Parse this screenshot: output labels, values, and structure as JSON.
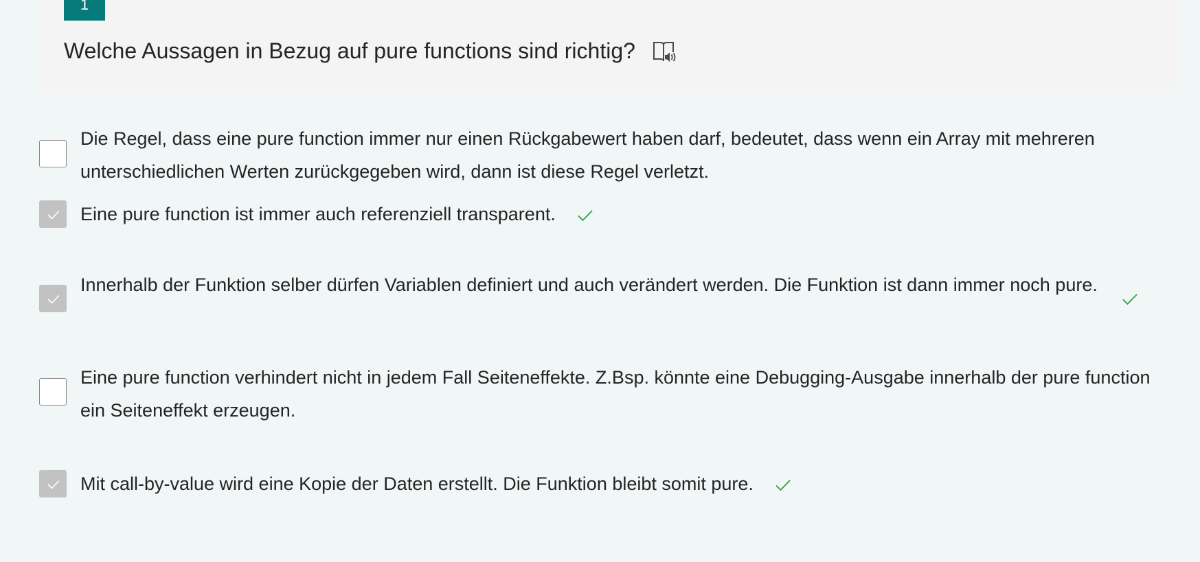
{
  "question": {
    "number": "1",
    "title": "Welche Aussagen in Bezug auf pure functions sind richtig?",
    "reader_icon": "immersive-reader-icon"
  },
  "options": [
    {
      "text": "Die Regel, dass eine pure function immer nur einen Rückgabewert haben darf, bedeutet, dass wenn ein Array mit mehreren unterschiedlichen Werten zurückgegeben wird, dann ist diese Regel verletzt.",
      "checked": false,
      "correct": false
    },
    {
      "text": "Eine pure function ist immer auch referenziell transparent.",
      "checked": true,
      "correct": true
    },
    {
      "text": "Innerhalb der Funktion selber dürfen Variablen definiert und auch verändert werden. Die Funktion ist dann immer noch pure.",
      "checked": true,
      "correct": true
    },
    {
      "text": "Eine pure function verhindert nicht in jedem Fall Seiteneffekte. Z.Bsp. könnte eine Debugging-Ausgabe innerhalb der pure function ein Seiteneffekt erzeugen.",
      "checked": false,
      "correct": false
    },
    {
      "text": "Mit call-by-value wird eine Kopie der Daten erstellt. Die Funktion bleibt somit pure.",
      "checked": true,
      "correct": true
    }
  ],
  "colors": {
    "accent": "#077a7a",
    "correct": "#2ea043",
    "checked_box": "#c2c2c2",
    "page_background": "#f1f6f7",
    "card_background": "#f4f4f4"
  }
}
